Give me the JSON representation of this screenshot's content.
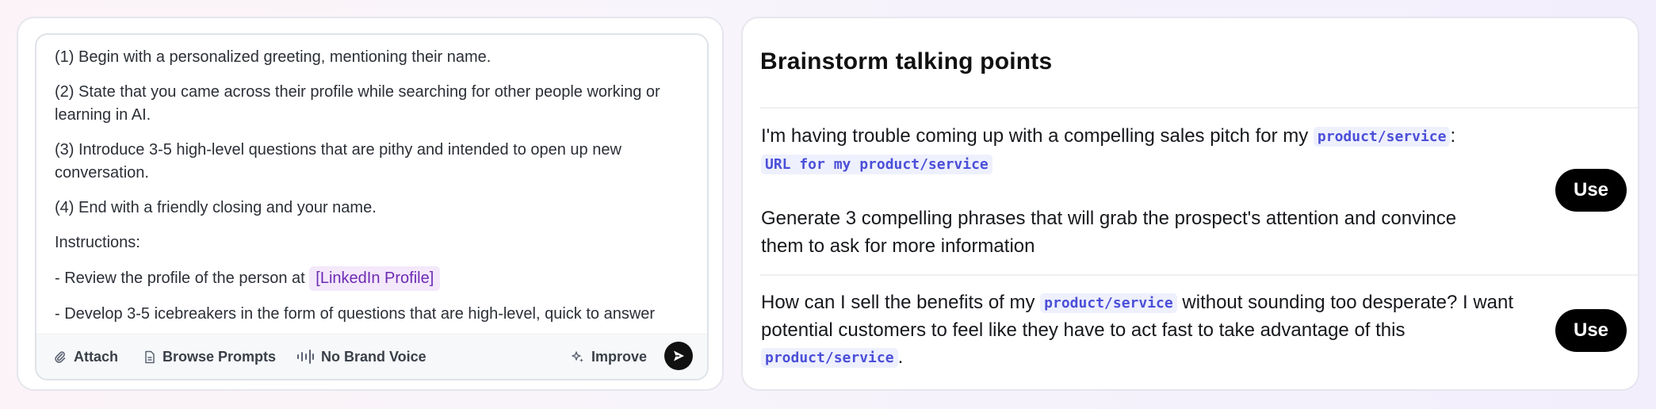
{
  "prompt": {
    "lines": [
      "(1) Begin with a personalized greeting, mentioning their name.",
      "(2) State that you came across their profile while searching for other people working or learning in AI.",
      "(3) Introduce 3-5 high-level questions that are pithy and intended to open up new conversation.",
      "(4) End with a friendly closing and your name.",
      "Instructions:",
      "- Review the profile of the person at",
      "- Develop 3-5 icebreakers in the form of questions that are high-level, quick to answer"
    ],
    "variable_chip": "[LinkedIn Profile]"
  },
  "toolbar": {
    "attach": "Attach",
    "browse": "Browse Prompts",
    "voice": "No Brand Voice",
    "improve": "Improve"
  },
  "brainstorm": {
    "title": "Brainstorm talking points",
    "use_label": "Use",
    "item1": {
      "text_a": "I'm having trouble coming up with a compelling sales pitch for my",
      "chip_product": "product/service",
      "colon": ":",
      "chip_url": "URL for my product/service",
      "paragraph2": "Generate 3 compelling phrases that will grab the prospect's attention and convince them to ask for more information"
    },
    "item2": {
      "text_a": "How can I sell the benefits of my",
      "chip_product": "product/service",
      "text_b": "without sounding too desperate? I want potential customers to feel like they have to act fast to take advantage of this",
      "chip_product2": "product/service",
      "end": "."
    }
  },
  "colors": {
    "accent_purple": "#6d2bb3",
    "chip_indigo": "#4b4fd8",
    "button_black": "#000000"
  }
}
